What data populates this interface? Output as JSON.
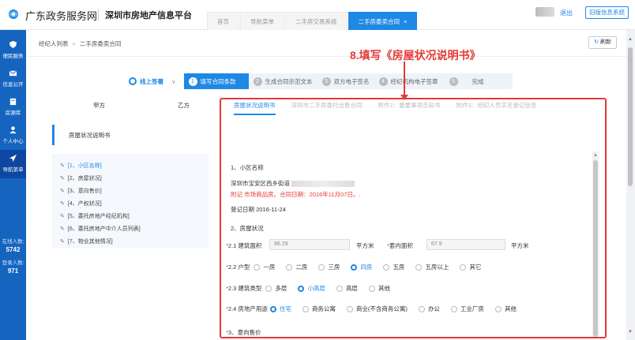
{
  "header": {
    "brand": "广东政务服务网",
    "platform": "深圳市房地产信息平台",
    "tabs": [
      {
        "label": "首页"
      },
      {
        "label": "导航菜单"
      },
      {
        "label": "二手房交易系统"
      },
      {
        "label": "二手房委卖合同",
        "close": "×"
      }
    ],
    "logout": "退出",
    "old_system": "旧版信息系统"
  },
  "sidebar": {
    "items": [
      {
        "label": "便民服务",
        "icon": "shield-icon"
      },
      {
        "label": "信息公开",
        "icon": "mail-icon"
      },
      {
        "label": "房源库",
        "icon": "building-icon"
      },
      {
        "label": "个人中心",
        "icon": "user-icon"
      },
      {
        "label": "导航菜单",
        "icon": "navigate-icon"
      }
    ],
    "stats": [
      {
        "label": "在线人数:",
        "value": "5742"
      },
      {
        "label": "登录人数:",
        "value": "971"
      }
    ]
  },
  "breadcrumb": {
    "items": [
      "经纪人列表",
      "二手房委卖合同"
    ],
    "separator": ">"
  },
  "refresh_label": "刷新",
  "annotation": "8.填写《房屋状况说明书》",
  "steps": {
    "online": "线上签署",
    "items": [
      {
        "n": "1",
        "label": "填写合同条款"
      },
      {
        "n": "2",
        "label": "生成合同示范文本"
      },
      {
        "n": "3",
        "label": "双方电子签名"
      },
      {
        "n": "4",
        "label": "经纪机构电子签章"
      },
      {
        "n": "5",
        "label": "完成"
      }
    ]
  },
  "parties": {
    "a": "甲方",
    "b": "乙方"
  },
  "doc_tabs": [
    "房屋状况说明书",
    "深圳市二手房委托出售合同",
    "附件2：重要事项告知书",
    "附件3：经纪人员实名登记信息"
  ],
  "left_panel": {
    "title": "房屋状况说明书",
    "items": [
      "[1、小区名称]",
      "[2、房屋状况]",
      "[3、意向售价]",
      "[4、产权状况]",
      "[5、委托房地产经纪机构]",
      "[6、委托房地产中介人员列表]",
      "[7、物业其他情况]"
    ]
  },
  "form": {
    "s1_title": "1、小区名称",
    "address": "深圳市宝安区西乡街道",
    "note": "附记 市场商品房。合同日期：2016年11月07日。.",
    "reg_date": "登记日期 2016-11-24",
    "s2_title": "2、房屋状况",
    "area_label": "2.1 建筑面积",
    "area_value": "86.29",
    "area_unit": "平方米",
    "inner_label": "套内面积",
    "inner_value": "67.9",
    "inner_unit": "平方米",
    "layout_label": "2.2 户型",
    "layout_options": [
      "一房",
      "二房",
      "三房",
      "四房",
      "五房",
      "五房以上",
      "其它"
    ],
    "layout_selected": 3,
    "build_label": "2.3 建筑类型",
    "build_options": [
      "多层",
      "小高层",
      "高层",
      "其他"
    ],
    "build_selected": 1,
    "use_label": "2.4 房地产用途",
    "use_options": [
      "住宅",
      "商务公寓",
      "商业(不含商务公寓)",
      "办公",
      "工业厂房",
      "其他"
    ],
    "use_selected": 0,
    "s3_title": "3、意向售价"
  },
  "colors": {
    "accent": "#1e88e5",
    "sidebar": "#1565c0",
    "annotation": "#e53935"
  }
}
